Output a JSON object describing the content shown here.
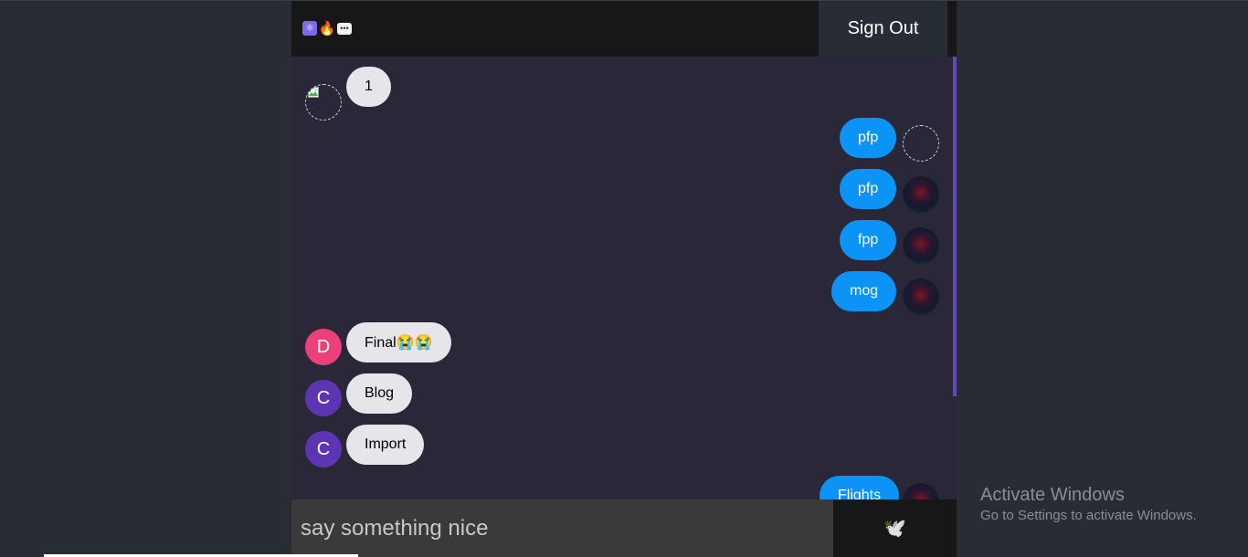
{
  "header": {
    "logo_icons": [
      "atom-icon",
      "fire-icon",
      "speech-bubble-icon"
    ],
    "logo_glyphs": [
      "⚛",
      "🔥",
      "💬"
    ],
    "signout_label": "Sign Out"
  },
  "messages": [
    {
      "text": "1",
      "type": "received",
      "avatar": "broken-image"
    },
    {
      "text": "pfp",
      "type": "sent",
      "avatar": "broken-image"
    },
    {
      "text": "pfp",
      "type": "sent",
      "avatar": "photo"
    },
    {
      "text": "fpp",
      "type": "sent",
      "avatar": "photo"
    },
    {
      "text": "mog",
      "type": "sent",
      "avatar": "photo"
    },
    {
      "text": "Final😭😭",
      "type": "received",
      "avatar": "letter",
      "avatar_letter": "D"
    },
    {
      "text": "Blog",
      "type": "received",
      "avatar": "letter",
      "avatar_letter": "C"
    },
    {
      "text": "Import",
      "type": "received",
      "avatar": "letter",
      "avatar_letter": "C"
    },
    {
      "text": "Flights",
      "type": "sent",
      "avatar": "photo"
    }
  ],
  "composer": {
    "placeholder": "say something nice",
    "value": "",
    "send_icon": "dove-icon",
    "send_glyph": "🕊️"
  },
  "watermark": {
    "title": "Activate Windows",
    "subtitle": "Go to Settings to activate Windows."
  },
  "colors": {
    "page_bg": "#282c34",
    "header_bg": "#181717",
    "chat_bg": "#2a2738",
    "sent_bubble": "#0b93f6",
    "received_bubble": "#e5e5ea",
    "scrollbar_thumb": "#6649b8",
    "avatar_d": "#ec407a",
    "avatar_c": "#5e35b1"
  }
}
